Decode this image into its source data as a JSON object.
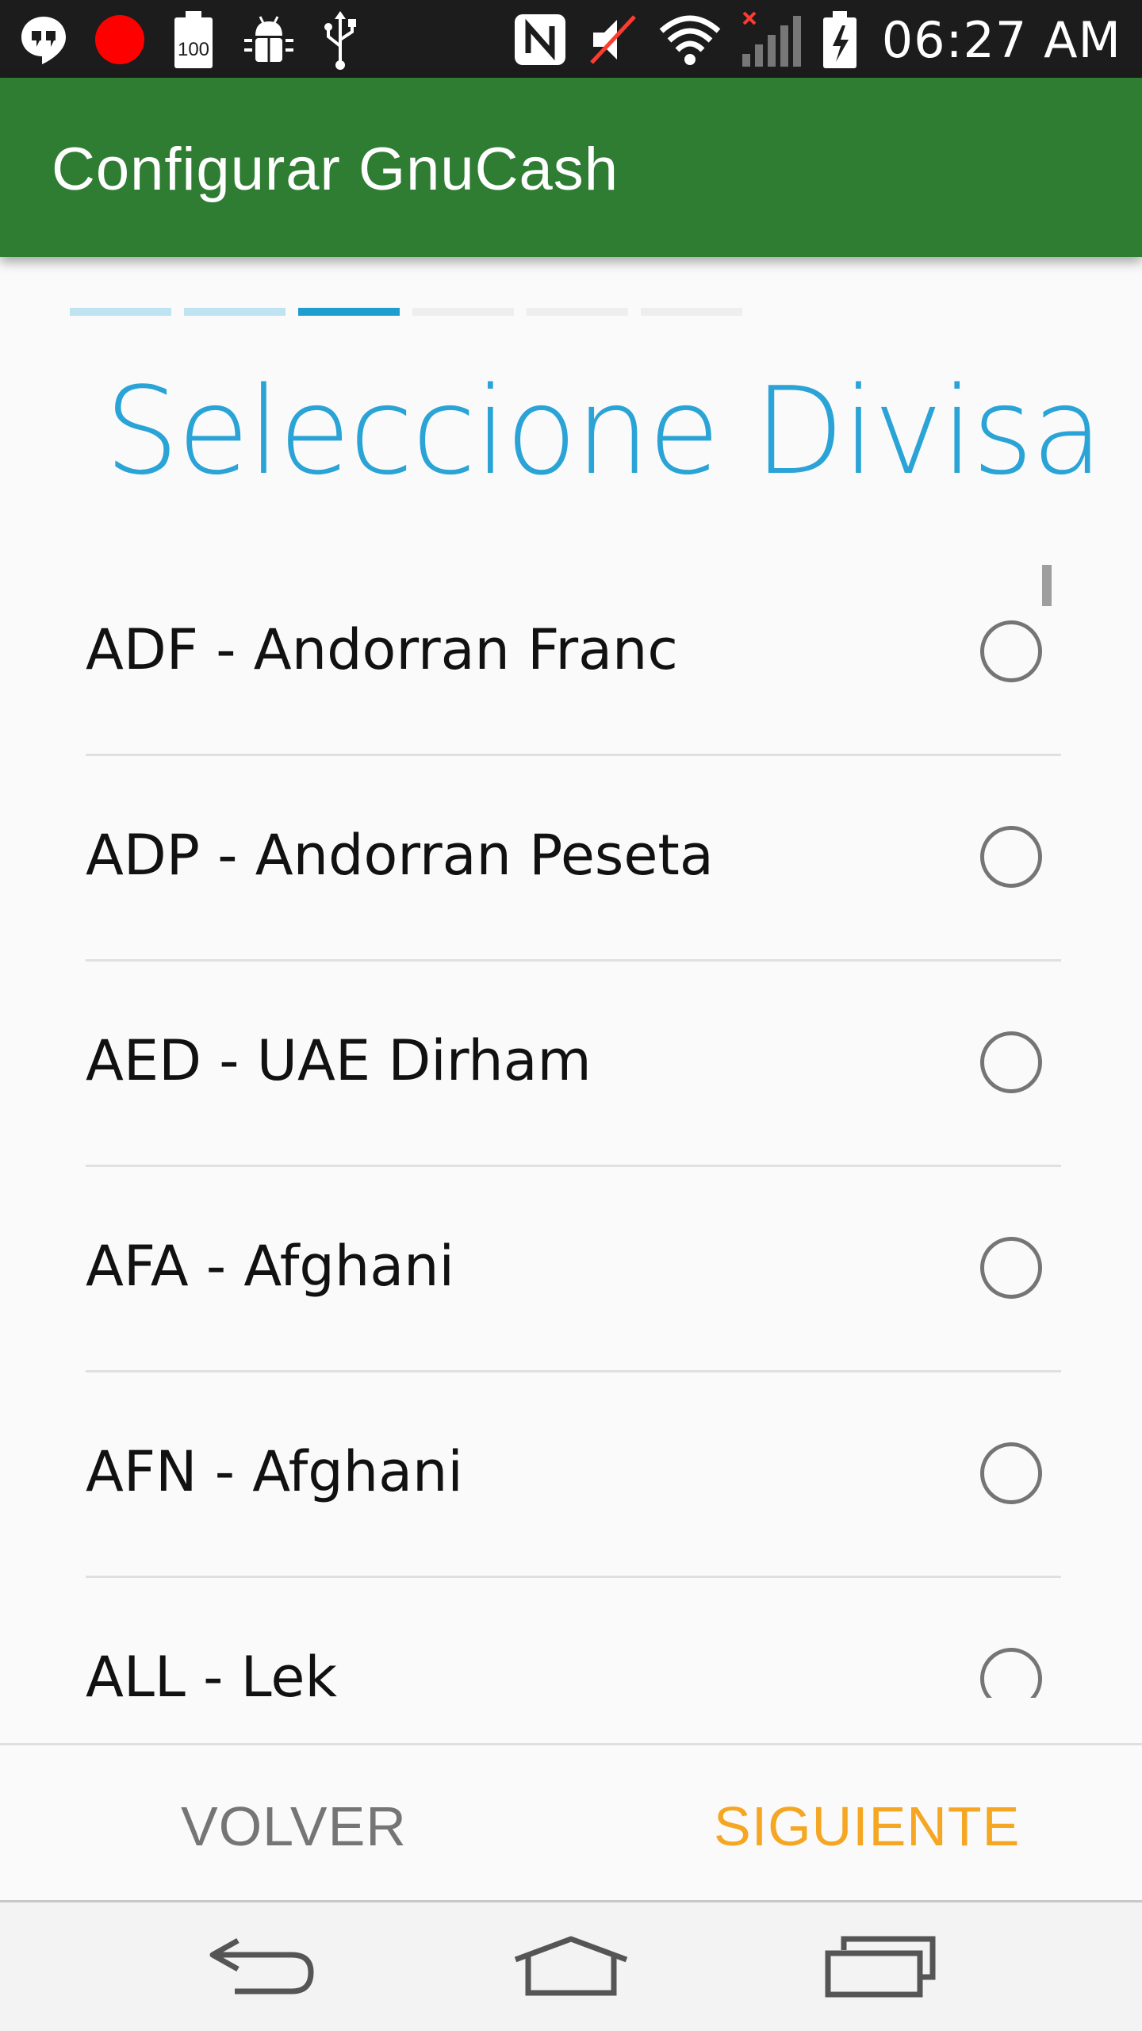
{
  "status_bar": {
    "time": "06:27 AM",
    "left_icons": [
      "hangouts-icon",
      "record-icon",
      "battery-100-icon",
      "android-debug-icon",
      "usb-icon"
    ],
    "right_icons": [
      "nfc-icon",
      "mute-icon",
      "wifi-icon",
      "signal-icon",
      "battery-charging-icon"
    ],
    "battery_label": "100"
  },
  "app_bar": {
    "title": "Configurar GnuCash",
    "color": "#2e7d32"
  },
  "stepper": {
    "total_steps": 6,
    "current_step": 3
  },
  "page": {
    "heading": "Seleccione Divisa",
    "heading_color": "#2aa3d6"
  },
  "currencies": [
    {
      "label": "ADF - Andorran Franc",
      "selected": false
    },
    {
      "label": "ADP - Andorran Peseta",
      "selected": false
    },
    {
      "label": "AED - UAE Dirham",
      "selected": false
    },
    {
      "label": "AFA - Afghani",
      "selected": false
    },
    {
      "label": "AFN - Afghani",
      "selected": false
    },
    {
      "label": "ALL - Lek",
      "selected": false
    }
  ],
  "buttons": {
    "back": "VOLVER",
    "next": "SIGUIENTE",
    "next_color": "#f5a623"
  },
  "nav_bar": {
    "icons": [
      "back-icon",
      "home-icon",
      "recents-icon"
    ]
  }
}
